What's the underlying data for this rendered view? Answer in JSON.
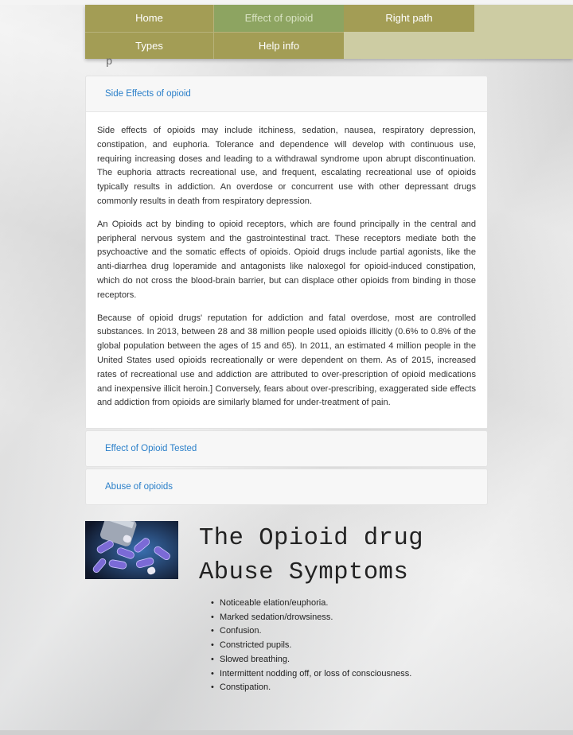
{
  "nav": {
    "items": [
      "Home",
      "Effect of opioid",
      "Right path",
      "Types",
      "Help info"
    ],
    "active": "Effect of opioid",
    "glimpse": "p",
    "colors": {
      "bar": "#a39d55",
      "active": "#8da461",
      "background": "#cdcca3"
    }
  },
  "accordion": {
    "panels": [
      {
        "title": "Side Effects of opioid",
        "expanded": true,
        "paragraphs": [
          "Side effects of opioids may include itchiness, sedation, nausea, respiratory depression, constipation, and euphoria. Tolerance and dependence will develop with continuous use, requiring increasing doses and leading to a withdrawal syndrome upon abrupt discontinuation. The euphoria attracts recreational use, and frequent, escalating recreational use of opioids typically results in addiction. An overdose or concurrent use with other depressant drugs commonly results in death from respiratory depression.",
          "An Opioids act by binding to opioid receptors, which are found principally in the central and peripheral nervous system and the gastrointestinal tract. These receptors mediate both the psychoactive and the somatic effects of opioids. Opioid drugs include partial agonists, like the anti-diarrhea drug loperamide and antagonists like naloxegol for opioid-induced constipation, which do not cross the blood-brain barrier, but can displace other opioids from binding in those receptors.",
          "Because of opioid drugs' reputation for addiction and fatal overdose, most are controlled substances. In 2013, between 28 and 38 million people used opioids illicitly (0.6% to 0.8% of the global population between the ages of 15 and 65). In 2011, an estimated 4 million people in the United States used opioids recreationally or were dependent on them. As of 2015, increased rates of recreational use and addiction are attributed to over-prescription of opioid medications and inexpensive illicit heroin.] Conversely, fears about over-prescribing, exaggerated side effects and addiction from opioids are similarly blamed for under-treatment of pain."
        ]
      },
      {
        "title": "Effect of Opioid Tested",
        "expanded": false
      },
      {
        "title": "Abuse of opioids",
        "expanded": false
      }
    ],
    "link_color": "#2a7fc9"
  },
  "symptoms_section": {
    "image_icon": "pills-photo",
    "heading_line1": "The Opioid drug",
    "heading_line2": "Abuse Symptoms",
    "items": [
      "Noticeable elation/euphoria.",
      "Marked sedation/drowsiness.",
      "Confusion.",
      "Constricted pupils.",
      "Slowed breathing.",
      "Intermittent nodding off, or loss of consciousness.",
      "Constipation."
    ]
  }
}
